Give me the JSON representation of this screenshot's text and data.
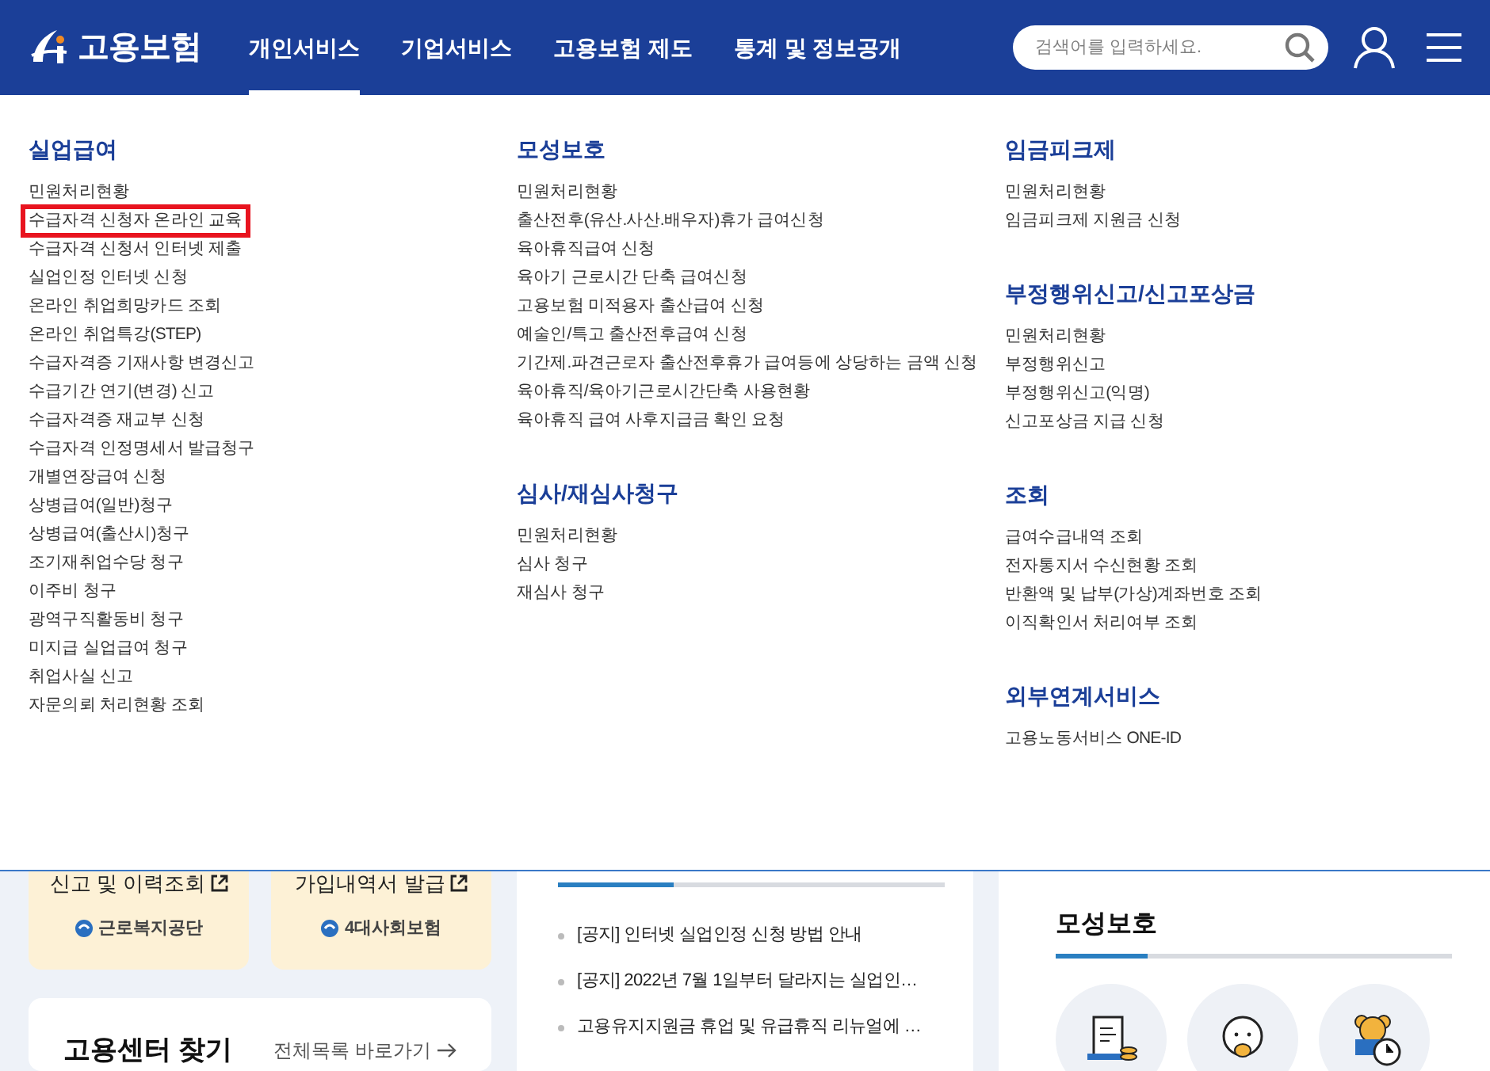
{
  "header": {
    "logo_text": "고용보험",
    "nav": [
      {
        "label": "개인서비스",
        "selected": true
      },
      {
        "label": "기업서비스",
        "selected": false
      },
      {
        "label": "고용보험 제도",
        "selected": false
      },
      {
        "label": "통계 및 정보공개",
        "selected": false
      }
    ],
    "search": {
      "placeholder": "검색어를 입력하세요."
    }
  },
  "menu_columns": [
    {
      "sections": [
        {
          "title": "실업급여",
          "items": [
            {
              "label": "민원처리현황",
              "highlighted": false
            },
            {
              "label": "수급자격 신청자 온라인 교육",
              "highlighted": true
            },
            {
              "label": "수급자격 신청서 인터넷 제출",
              "highlighted": false
            },
            {
              "label": "실업인정 인터넷 신청",
              "highlighted": false
            },
            {
              "label": "온라인 취업희망카드 조회",
              "highlighted": false
            },
            {
              "label": "온라인 취업특강(STEP)",
              "highlighted": false
            },
            {
              "label": "수급자격증 기재사항 변경신고",
              "highlighted": false
            },
            {
              "label": "수급기간 연기(변경) 신고",
              "highlighted": false
            },
            {
              "label": "수급자격증 재교부 신청",
              "highlighted": false
            },
            {
              "label": "수급자격 인정명세서 발급청구",
              "highlighted": false
            },
            {
              "label": "개별연장급여 신청",
              "highlighted": false
            },
            {
              "label": "상병급여(일반)청구",
              "highlighted": false
            },
            {
              "label": "상병급여(출산시)청구",
              "highlighted": false
            },
            {
              "label": "조기재취업수당 청구",
              "highlighted": false
            },
            {
              "label": "이주비 청구",
              "highlighted": false
            },
            {
              "label": "광역구직활동비 청구",
              "highlighted": false
            },
            {
              "label": "미지급 실업급여 청구",
              "highlighted": false
            },
            {
              "label": "취업사실 신고",
              "highlighted": false
            },
            {
              "label": "자문의뢰 처리현황 조회",
              "highlighted": false
            }
          ]
        }
      ]
    },
    {
      "sections": [
        {
          "title": "모성보호",
          "items": [
            {
              "label": "민원처리현황",
              "highlighted": false
            },
            {
              "label": "출산전후(유산.사산.배우자)휴가 급여신청",
              "highlighted": false
            },
            {
              "label": "육아휴직급여 신청",
              "highlighted": false
            },
            {
              "label": "육아기 근로시간 단축 급여신청",
              "highlighted": false
            },
            {
              "label": "고용보험 미적용자 출산급여 신청",
              "highlighted": false
            },
            {
              "label": "예술인/특고 출산전후급여 신청",
              "highlighted": false
            },
            {
              "label": "기간제.파견근로자 출산전후휴가 급여등에 상당하는 금액 신청",
              "highlighted": false
            },
            {
              "label": "육아휴직/육아기근로시간단축 사용현황",
              "highlighted": false
            },
            {
              "label": "육아휴직 급여 사후지급금 확인 요청",
              "highlighted": false
            }
          ]
        },
        {
          "title": "심사/재심사청구",
          "items": [
            {
              "label": "민원처리현황",
              "highlighted": false
            },
            {
              "label": "심사 청구",
              "highlighted": false
            },
            {
              "label": "재심사 청구",
              "highlighted": false
            }
          ]
        }
      ]
    },
    {
      "sections": [
        {
          "title": "임금피크제",
          "items": [
            {
              "label": "민원처리현황",
              "highlighted": false
            },
            {
              "label": "임금피크제 지원금 신청",
              "highlighted": false
            }
          ]
        },
        {
          "title": "부정행위신고/신고포상금",
          "items": [
            {
              "label": "민원처리현황",
              "highlighted": false
            },
            {
              "label": "부정행위신고",
              "highlighted": false
            },
            {
              "label": "부정행위신고(익명)",
              "highlighted": false
            },
            {
              "label": "신고포상금 지급 신청",
              "highlighted": false
            }
          ]
        },
        {
          "title": "조회",
          "items": [
            {
              "label": "급여수급내역 조회",
              "highlighted": false
            },
            {
              "label": "전자통지서 수신현황 조회",
              "highlighted": false
            },
            {
              "label": "반환액 및 납부(가상)계좌번호 조회",
              "highlighted": false
            },
            {
              "label": "이직확인서 처리여부 조회",
              "highlighted": false
            }
          ]
        },
        {
          "title": "외부연계서비스",
          "items": [
            {
              "label": "고용노동서비스 ONE-ID",
              "highlighted": false
            }
          ]
        }
      ]
    }
  ],
  "background": {
    "shortcut_cards": [
      {
        "label": "신고 및 이력조회",
        "org": "근로복지공단"
      },
      {
        "label": "가입내역서 발급",
        "org": "4대사회보험"
      }
    ],
    "center_finder": {
      "title": "고용센터 찾기",
      "link": "전체목록 바로가기"
    },
    "notices": {
      "level": 0.3,
      "items": [
        "[공지] 인터넷 실업인정 신청 방법 안내",
        "[공지] 2022년 7월 1일부터 달라지는 실업인…",
        "고용유지지원금 휴업 및 유급휴직 리뉴얼에 …"
      ]
    },
    "maternity": {
      "title": "모성보호",
      "level": 0.23
    }
  }
}
